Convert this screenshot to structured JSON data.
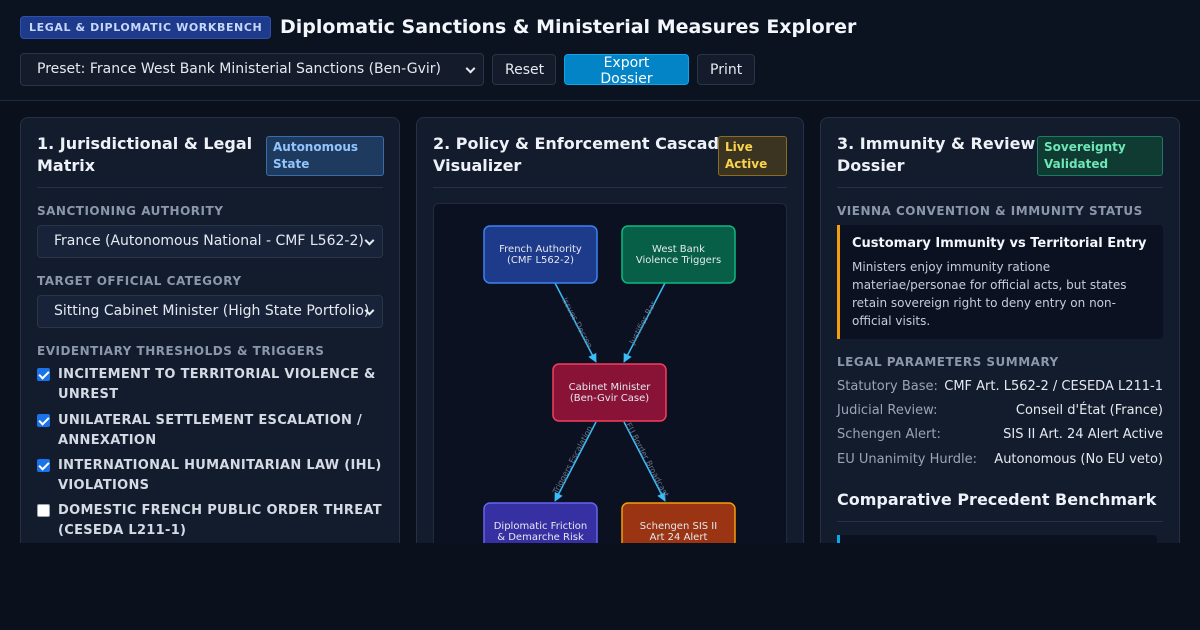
{
  "header": {
    "badge": "LEGAL & DIPLOMATIC WORKBENCH",
    "title": "Diplomatic Sanctions & Ministerial Measures Explorer",
    "preset_value": "Preset: France West Bank Ministerial Sanctions (Ben-Gvir)",
    "reset_label": "Reset",
    "export_label": "Export Dossier",
    "print_label": "Print"
  },
  "panel1": {
    "title_line1": "1. Jurisdictional & Legal",
    "title_line2": "Matrix",
    "tag_line1": "Autonomous",
    "tag_line2": "State",
    "authority_label": "SANCTIONING AUTHORITY",
    "authority_value": "France (Autonomous National - CMF L562-2)",
    "category_label": "TARGET OFFICIAL CATEGORY",
    "category_value": "Sitting Cabinet Minister (High State Portfolio)",
    "thresholds_label": "EVIDENTIARY THRESHOLDS & TRIGGERS",
    "triggers": [
      {
        "line1": "INCITEMENT TO TERRITORIAL VIOLENCE &",
        "line2": "UNREST",
        "checked": true
      },
      {
        "line1": "UNILATERAL SETTLEMENT ESCALATION /",
        "line2": "ANNEXATION",
        "checked": true
      },
      {
        "line1": "INTERNATIONAL HUMANITARIAN LAW (IHL)",
        "line2": "VIOLATIONS",
        "checked": true
      },
      {
        "line1": "DOMESTIC FRENCH PUBLIC ORDER THREAT",
        "line2": "(CESEDA L211-1)",
        "checked": false
      }
    ]
  },
  "panel2": {
    "title_line1": "2. Policy & Enforcement Cascade",
    "title_line2": "Visualizer",
    "tag_line1": "Live",
    "tag_line2": "Active",
    "nodes": {
      "authority": {
        "line1": "French Authority",
        "line2": "(CMF L562-2)"
      },
      "triggers": {
        "line1": "West Bank",
        "line2": "Violence Triggers"
      },
      "minister": {
        "line1": "Cabinet Minister",
        "line2": "(Ben-Gvir Case)"
      },
      "friction": {
        "line1": "Diplomatic Friction",
        "line2": "& Demarche Risk"
      },
      "schengen": {
        "line1": "Schengen SIS II",
        "line2": "Art 24 Alert"
      }
    },
    "edges": {
      "issues": "Issues Decree",
      "justifies": "Justifies Bar",
      "friction": "Triggers Escalation",
      "border": "EU Border Broadcast"
    },
    "colors": {
      "authority": "#1e3a8a",
      "triggers": "#065f46",
      "minister": "#881337",
      "friction": "#3730a3",
      "schengen": "#9a3412",
      "edge": "#38bdf8"
    }
  },
  "panel3": {
    "title_line1": "3. Immunity & Review",
    "title_line2": "Dossier",
    "tag_line1": "Sovereignty",
    "tag_line2": "Validated",
    "vienna_label": "VIENNA CONVENTION & IMMUNITY STATUS",
    "callout_title": "Customary Immunity vs Territorial Entry",
    "callout_lines": [
      "Ministers enjoy immunity ratione",
      "materiae/personae for official acts, but states",
      "retain sovereign right to deny entry on non-",
      "official visits."
    ],
    "summary_label": "LEGAL PARAMETERS SUMMARY",
    "params": [
      {
        "key": "Statutory Base:",
        "value": "CMF Art. L562-2 / CESEDA L211-1"
      },
      {
        "key": "Judicial Review:",
        "value": "Conseil d'État (France)"
      },
      {
        "key": "Schengen Alert:",
        "value": "SIS II Art. 24 Alert Active"
      },
      {
        "key": "EU Unanimity Hurdle:",
        "value": "Autonomous (No EU veto)"
      }
    ],
    "benchmark_title": "Comparative Precedent Benchmark"
  }
}
